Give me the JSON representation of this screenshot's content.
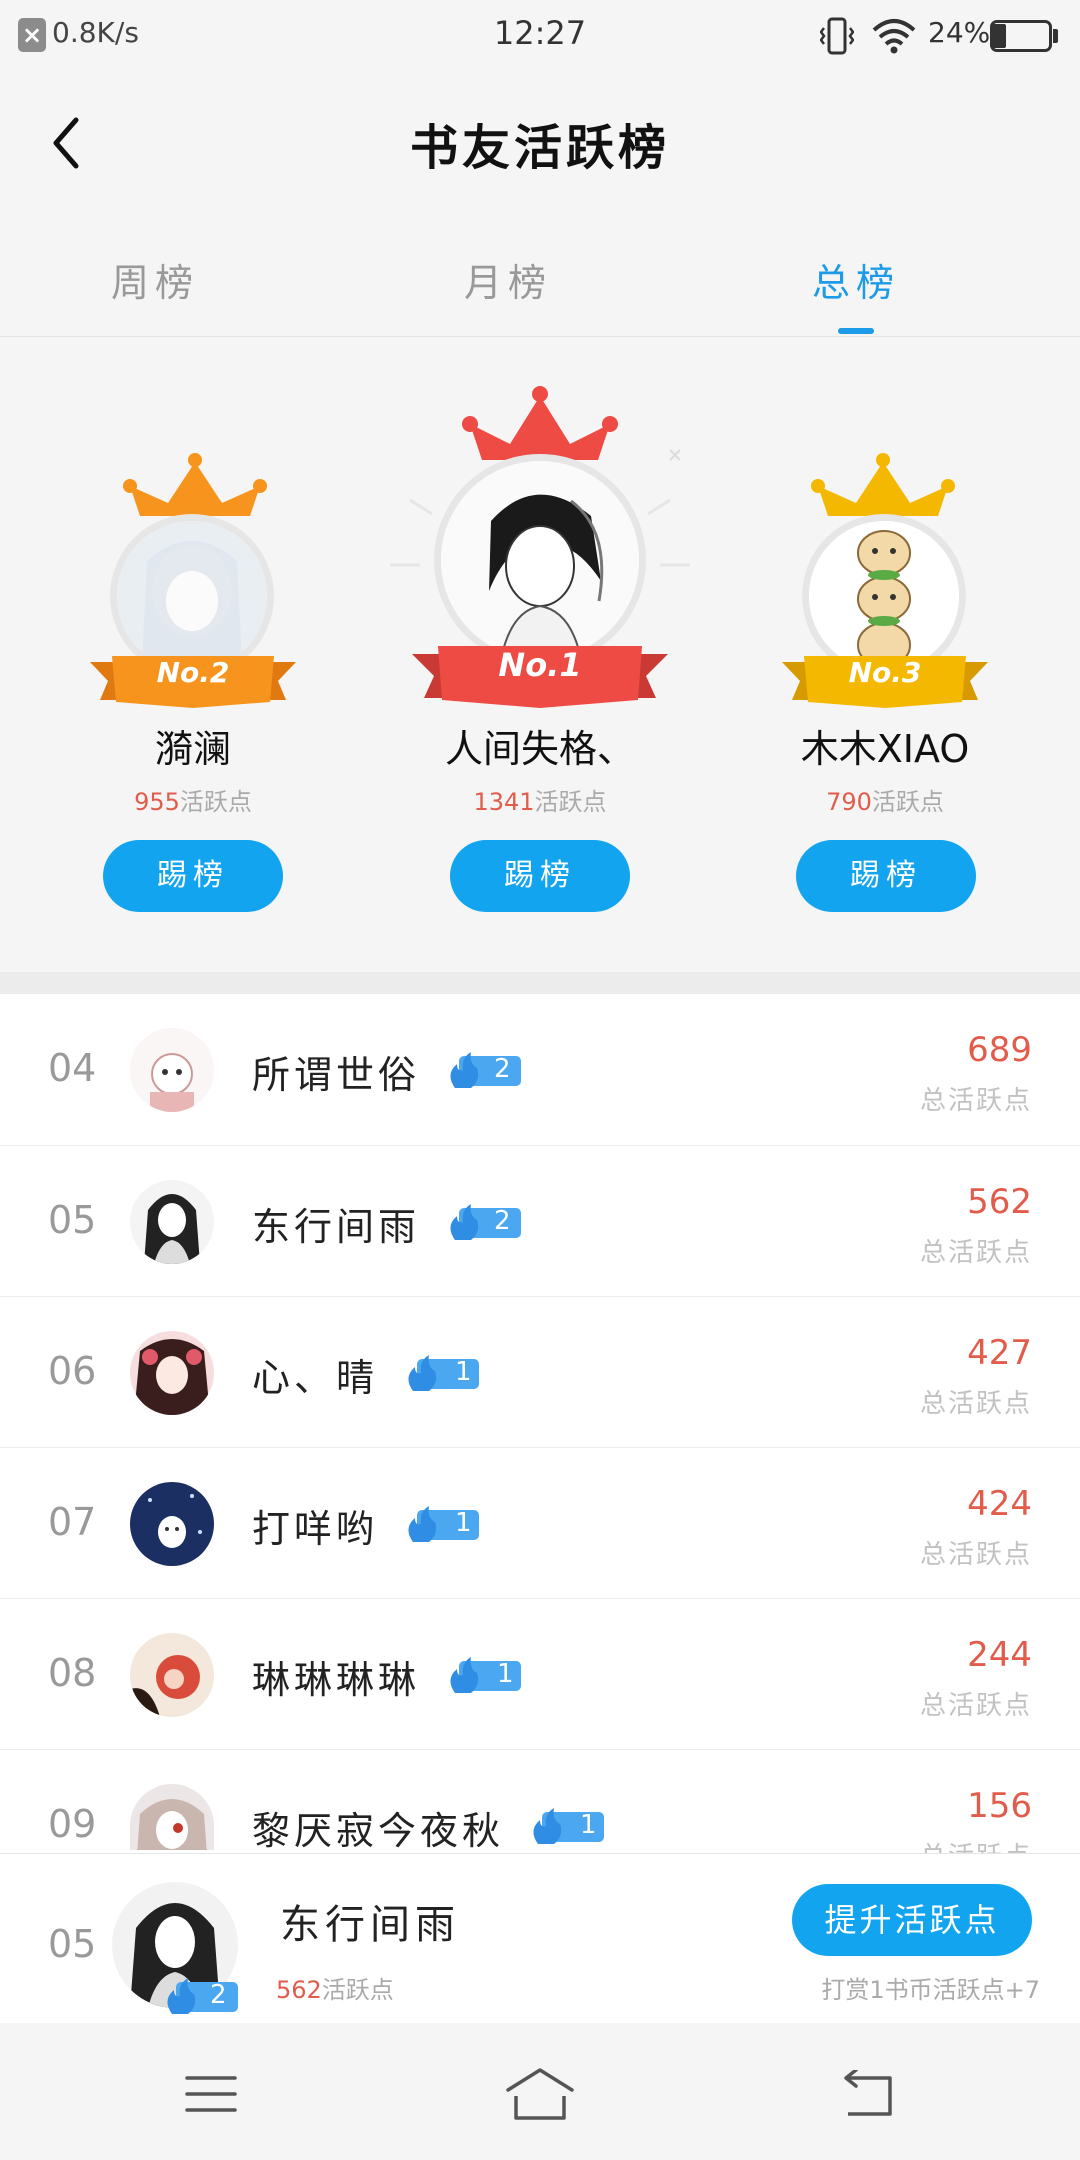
{
  "status_bar": {
    "x_icon": "×",
    "speed": "0.8K/s",
    "time": "12:27",
    "battery_percent": "24%",
    "battery_level": 0.24,
    "icons": [
      "close-icon",
      "vibrate-icon",
      "wifi-icon",
      "battery-icon"
    ]
  },
  "header": {
    "title": "书友活跃榜",
    "back_icon": "chevron-left-icon"
  },
  "tabs": [
    {
      "label": "周榜",
      "active": false
    },
    {
      "label": "月榜",
      "active": false
    },
    {
      "label": "总榜",
      "active": true
    }
  ],
  "podium": {
    "first": {
      "rank_label": "No.1",
      "name": "人间失格、",
      "score": "1341",
      "score_suffix": "活跃点",
      "button": "踢榜"
    },
    "second": {
      "rank_label": "No.2",
      "name": "漪澜",
      "score": "955",
      "score_suffix": "活跃点",
      "button": "踢榜"
    },
    "third": {
      "rank_label": "No.3",
      "name": "木木XIAO",
      "score": "790",
      "score_suffix": "活跃点",
      "button": "踢榜"
    }
  },
  "list": [
    {
      "rank": "04",
      "name": "所谓世俗",
      "level": "2",
      "score": "689",
      "label": "总活跃点"
    },
    {
      "rank": "05",
      "name": "东行间雨",
      "level": "2",
      "score": "562",
      "label": "总活跃点"
    },
    {
      "rank": "06",
      "name": "心、晴",
      "level": "1",
      "score": "427",
      "label": "总活跃点"
    },
    {
      "rank": "07",
      "name": "打咩哟",
      "level": "1",
      "score": "424",
      "label": "总活跃点"
    },
    {
      "rank": "08",
      "name": "琳琳琳琳",
      "level": "1",
      "score": "244",
      "label": "总活跃点"
    },
    {
      "rank": "09",
      "name": "黎厌寂今夜秋",
      "level": "1",
      "score": "156",
      "label": "总活跃点"
    }
  ],
  "me": {
    "rank": "05",
    "name": "东行间雨",
    "level": "2",
    "score": "562",
    "score_suffix": "活跃点",
    "button": "提升活跃点",
    "hint": "打赏1书币活跃点+7"
  },
  "colors": {
    "accent": "#13a4f0",
    "tab_active": "#1e9be8",
    "score": "#e25c4b",
    "gold": "#f5b800",
    "orange": "#f7941d",
    "red": "#ee4b45"
  },
  "nav": [
    "menu-icon",
    "home-icon",
    "back-icon"
  ]
}
